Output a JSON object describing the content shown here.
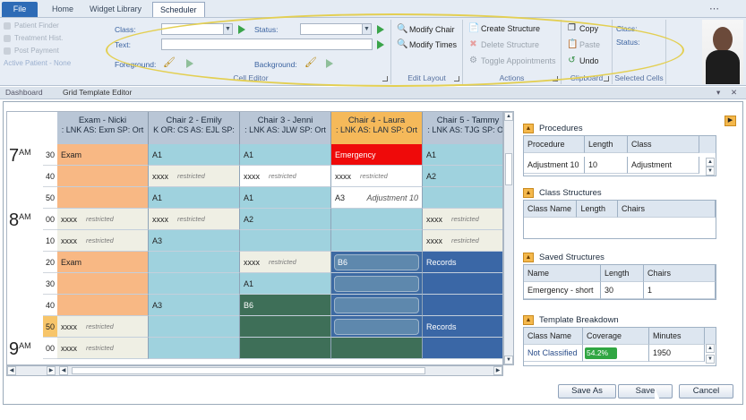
{
  "tabs": [
    {
      "label": "File"
    },
    {
      "label": "Home"
    },
    {
      "label": "Widget Library"
    },
    {
      "label": "Scheduler"
    }
  ],
  "left_faded": [
    "Patient Finder",
    "Treatment Hist.",
    "Post Payment",
    "Active Patient - None"
  ],
  "cell_editor": {
    "class_label": "Class:",
    "status_label": "Status:",
    "text_label": "Text:",
    "foreground_label": "Foreground:",
    "background_label": "Background:",
    "group_label": "Cell Editor"
  },
  "edit_layout": {
    "modify_chair": "Modify Chair",
    "modify_times": "Modify Times",
    "group_label": "Edit Layout"
  },
  "actions": {
    "create": "Create Structure",
    "delete": "Delete Structure",
    "toggle": "Toggle Appointments",
    "group_label": "Actions"
  },
  "clipboard": {
    "copy": "Copy",
    "paste": "Paste",
    "undo": "Undo",
    "group_label": "Clipboard"
  },
  "selected_cells": {
    "class_label": "Class:",
    "status_label": "Status:",
    "group_label": "Selected Cells"
  },
  "doc_tabs": {
    "dashboard": "Dashboard",
    "editor": "Grid Template Editor"
  },
  "columns": [
    {
      "title": "Exam - Nicki",
      "sub": ": LNK  AS: Exm  SP: Ort"
    },
    {
      "title": "Chair 2 - Emily",
      "sub": "K  OR: CS  AS: EJL  SP:"
    },
    {
      "title": "Chair 3 - Jenni",
      "sub": ": LNK  AS: JLW  SP: Ort"
    },
    {
      "title": "Chair 4 - Laura",
      "sub": ": LNK  AS: LAN  SP: Ort"
    },
    {
      "title": "Chair 5 - Tammy",
      "sub": ": LNK  AS: TJG  SP: Ort"
    }
  ],
  "hours": [
    {
      "h": "7",
      "ampm": "AM"
    },
    {
      "h": "8",
      "ampm": "AM"
    },
    {
      "h": "9",
      "ampm": "AM"
    }
  ],
  "minutes": [
    "30",
    "40",
    "50",
    "00",
    "10",
    "20",
    "30",
    "40",
    "50",
    "00"
  ],
  "rows": [
    [
      {
        "t": "Exam",
        "c": "#f8b884"
      },
      {
        "t": "A1",
        "c": "#9fd2de"
      },
      {
        "t": "A1",
        "c": "#9fd2de"
      },
      {
        "t": "Emergency",
        "c": "#ef0a0a",
        "fg": "#fff"
      },
      {
        "t": "A1",
        "c": "#9fd2de"
      }
    ],
    [
      {
        "t": "",
        "c": "#f8b884"
      },
      {
        "t": "xxxx",
        "r": "restricted",
        "c": "#efefe4"
      },
      {
        "t": "xxxx",
        "r": "restricted",
        "c": "#fff"
      },
      {
        "t": "xxxx",
        "r": "restricted",
        "c": "#fff"
      },
      {
        "t": "A2",
        "c": "#9fd2de"
      }
    ],
    [
      {
        "t": "",
        "c": "#f8b884"
      },
      {
        "t": "A1",
        "c": "#9fd2de"
      },
      {
        "t": "A1",
        "c": "#9fd2de"
      },
      {
        "t": "A3",
        "c": "#fff",
        "ann": "Adjustment 10"
      },
      {
        "t": "",
        "c": "#9fd2de"
      }
    ],
    [
      {
        "t": "xxxx",
        "r": "restricted",
        "c": "#efefe4"
      },
      {
        "t": "xxxx",
        "r": "restricted",
        "c": "#efefe4"
      },
      {
        "t": "A2",
        "c": "#9fd2de"
      },
      {
        "t": "",
        "c": "#9fd2de"
      },
      {
        "t": "xxxx",
        "r": "restricted",
        "c": "#efefe4"
      }
    ],
    [
      {
        "t": "xxxx",
        "r": "restricted",
        "c": "#efefe4"
      },
      {
        "t": "A3",
        "c": "#9fd2de"
      },
      {
        "t": "",
        "c": "#9fd2de"
      },
      {
        "t": "",
        "c": "#9fd2de"
      },
      {
        "t": "xxxx",
        "r": "restricted",
        "c": "#efefe4"
      }
    ],
    [
      {
        "t": "Exam",
        "c": "#f8b884"
      },
      {
        "t": "",
        "c": "#9fd2de"
      },
      {
        "t": "xxxx",
        "r": "restricted",
        "c": "#efefe4"
      },
      {
        "t": "B6",
        "c": "#3d6aa3",
        "pill": true
      },
      {
        "t": "Records",
        "c": "#3a67a6",
        "fg": "#fff"
      }
    ],
    [
      {
        "t": "",
        "c": "#f8b884"
      },
      {
        "t": "",
        "c": "#9fd2de"
      },
      {
        "t": "A1",
        "c": "#9fd2de"
      },
      {
        "t": "",
        "c": "#3d6aa3",
        "pill": true
      },
      {
        "t": "",
        "c": "#3a67a6"
      }
    ],
    [
      {
        "t": "",
        "c": "#f8b884"
      },
      {
        "t": "A3",
        "c": "#9fd2de"
      },
      {
        "t": "B6",
        "c": "#3e6f58",
        "fg": "#fff"
      },
      {
        "t": "",
        "c": "#3d6aa3",
        "pill": true
      },
      {
        "t": "",
        "c": "#3a67a6"
      }
    ],
    [
      {
        "t": "xxxx",
        "r": "restricted",
        "c": "#efefe4"
      },
      {
        "t": "",
        "c": "#9fd2de"
      },
      {
        "t": "",
        "c": "#3e6f58"
      },
      {
        "t": "",
        "c": "#3d6aa3",
        "pill": true
      },
      {
        "t": "Records",
        "c": "#3a67a6",
        "fg": "#fff"
      }
    ],
    [
      {
        "t": "xxxx",
        "r": "restricted",
        "c": "#efefe4"
      },
      {
        "t": "",
        "c": "#9fd2de"
      },
      {
        "t": "",
        "c": "#3e6f58"
      },
      {
        "t": "",
        "c": "#3e6f58"
      },
      {
        "t": "",
        "c": "#3a67a6"
      }
    ]
  ],
  "procedures": {
    "title": "Procedures",
    "headers": [
      "Procedure",
      "Length",
      "Class"
    ],
    "rows": [
      [
        "Adjustment 10",
        "10",
        "Adjustment"
      ]
    ]
  },
  "class_structures": {
    "title": "Class Structures",
    "headers": [
      "Class Name",
      "Length",
      "Chairs"
    ]
  },
  "saved_structures": {
    "title": "Saved Structures",
    "headers": [
      "Name",
      "Length",
      "Chairs"
    ],
    "rows": [
      [
        "Emergency - short",
        "30",
        "1"
      ]
    ]
  },
  "template_breakdown": {
    "title": "Template Breakdown",
    "headers": [
      "Class Name",
      "Coverage",
      "Minutes"
    ],
    "rows": [
      [
        "Not Classified",
        "54.2%",
        "1950"
      ]
    ],
    "coverage": 0.542
  },
  "buttons": {
    "save_as": "Save As",
    "save": "Save",
    "cancel": "Cancel"
  },
  "colors": {
    "accent": "#2d6bb6",
    "selected_col": "#f5b95a",
    "highlight_ring": "#e3cf52"
  }
}
